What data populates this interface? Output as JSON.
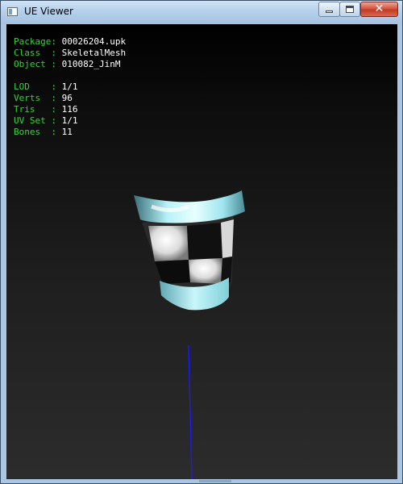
{
  "window": {
    "title": "UE Viewer",
    "close_glyph": "✕"
  },
  "icons": {
    "app": "app-window-icon",
    "minimize": "minimize-icon",
    "maximize": "maximize-icon",
    "close": "close-icon"
  },
  "info": {
    "package": {
      "label": "Package:",
      "value": "00026204.upk"
    },
    "class": {
      "label": "Class  :",
      "value": "SkeletalMesh"
    },
    "object": {
      "label": "Object :",
      "value": "010082_JinM"
    },
    "lod": {
      "label": "LOD    :",
      "value": "1/1"
    },
    "verts": {
      "label": "Verts  :",
      "value": "96"
    },
    "tris": {
      "label": "Tris   :",
      "value": "116"
    },
    "uvset": {
      "label": "UV Set :",
      "value": "1/1"
    },
    "bones": {
      "label": "Bones  :",
      "value": "11"
    }
  },
  "colors": {
    "label_green": "#33d633",
    "value_white": "#ffffff",
    "axis_blue": "#1a1aff",
    "mesh_cyan": "#9ee6ee"
  }
}
